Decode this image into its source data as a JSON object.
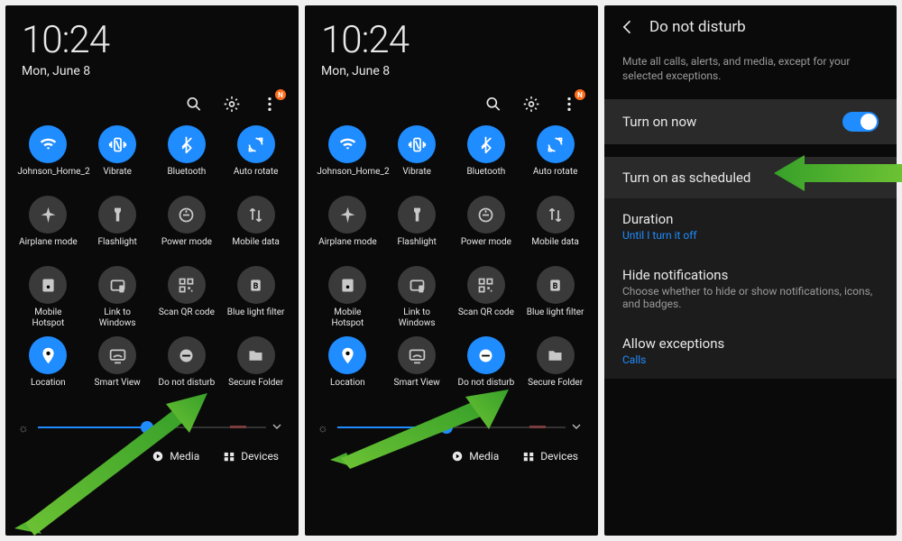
{
  "clock": "10:24",
  "date": "Mon, June 8",
  "overflow_badge": "N",
  "tiles": [
    {
      "label": "Johnson_Home_2",
      "on": true,
      "icon": "wifi"
    },
    {
      "label": "Vibrate",
      "on": true,
      "icon": "vibrate"
    },
    {
      "label": "Bluetooth",
      "on": true,
      "icon": "bluetooth"
    },
    {
      "label": "Auto rotate",
      "on": true,
      "icon": "rotate"
    },
    {
      "label": "Airplane mode",
      "on": false,
      "icon": "airplane"
    },
    {
      "label": "Flashlight",
      "on": false,
      "icon": "flashlight"
    },
    {
      "label": "Power mode",
      "on": false,
      "icon": "power"
    },
    {
      "label": "Mobile data",
      "on": false,
      "icon": "mobiledata"
    },
    {
      "label": "Mobile Hotspot",
      "on": false,
      "icon": "hotspot"
    },
    {
      "label": "Link to Windows",
      "on": false,
      "icon": "link"
    },
    {
      "label": "Scan QR code",
      "on": false,
      "icon": "qr"
    },
    {
      "label": "Blue light filter",
      "on": false,
      "icon": "bluelight"
    },
    {
      "label": "Location",
      "on": true,
      "icon": "location"
    },
    {
      "label": "Smart View",
      "on": false,
      "icon": "smartview"
    },
    {
      "label": "Do not disturb",
      "off_variant": true,
      "icon": "dnd"
    },
    {
      "label": "Secure Folder",
      "on": false,
      "icon": "folder"
    }
  ],
  "dnd_on_in_panel2": true,
  "footer": {
    "media": "Media",
    "devices": "Devices"
  },
  "p3": {
    "title": "Do not disturb",
    "desc": "Mute all calls, alerts, and media, except for your selected exceptions.",
    "turn_on_now": "Turn on now",
    "turn_on_sched": "Turn on as scheduled",
    "duration": "Duration",
    "duration_sub": "Until I turn it off",
    "hide": "Hide notifications",
    "hide_sub": "Choose whether to hide or show notifications, icons, and badges.",
    "allow": "Allow exceptions",
    "allow_sub": "Calls"
  }
}
